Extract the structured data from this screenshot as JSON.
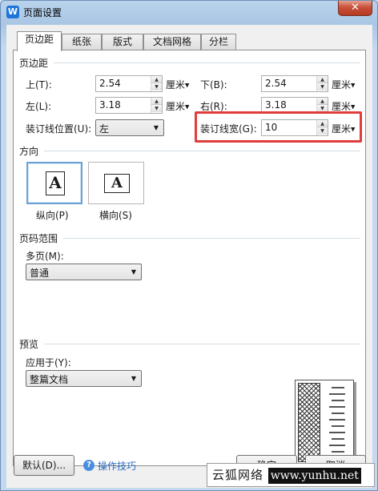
{
  "window": {
    "title": "页面设置",
    "app_icon": "W"
  },
  "tabs": [
    {
      "label": "页边距",
      "active": true
    },
    {
      "label": "纸张"
    },
    {
      "label": "版式"
    },
    {
      "label": "文档网格"
    },
    {
      "label": "分栏"
    }
  ],
  "margins": {
    "group_title": "页边距",
    "top": {
      "label": "上(T):",
      "value": "2.54",
      "unit": "厘米"
    },
    "bottom": {
      "label": "下(B):",
      "value": "2.54",
      "unit": "厘米"
    },
    "left": {
      "label": "左(L):",
      "value": "3.18",
      "unit": "厘米"
    },
    "right": {
      "label": "右(R):",
      "value": "3.18",
      "unit": "厘米"
    },
    "gutter_position": {
      "label": "装订线位置(U):",
      "value": "左"
    },
    "gutter_width": {
      "label": "装订线宽(G):",
      "value": "10",
      "unit": "厘米"
    }
  },
  "orientation": {
    "group_title": "方向",
    "portrait": {
      "label": "纵向(P)",
      "glyph": "A",
      "selected": true
    },
    "landscape": {
      "label": "横向(S)",
      "glyph": "A"
    }
  },
  "page_range": {
    "group_title": "页码范围",
    "multiple_label": "多页(M):",
    "value": "普通"
  },
  "preview": {
    "group_title": "预览",
    "apply_label": "应用于(Y):",
    "apply_value": "整篇文档"
  },
  "footer": {
    "default_button": "默认(D)...",
    "tips_link": "操作技巧",
    "ok_button": "确定",
    "cancel_button": "取消"
  },
  "watermark": {
    "text": "云狐网络",
    "url": "www.yunhu.net"
  },
  "colors": {
    "highlight": "#e03c3c",
    "link": "#2c6cc0",
    "tips_icon": "#4a8ee0"
  }
}
